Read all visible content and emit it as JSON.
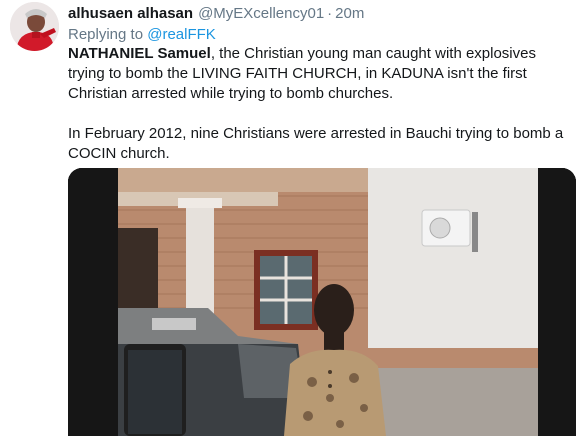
{
  "tweet": {
    "author_name": "alhusaen alhasan",
    "author_handle": "@MyEXcellency01",
    "separator": "·",
    "timestamp": "20m",
    "replying_prefix": "Replying to",
    "replying_to": "@realFFK",
    "body_name": "NATHANIEL Samuel",
    "body_line1_rest": ", the Christian young man caught with explosives trying to bomb the LIVING FAITH CHURCH, in KADUNA isn't the first Christian arrested while trying to bomb churches.",
    "body_para2": "In February 2012, nine Christians were arrested in Bauchi trying to bomb a COCIN church."
  },
  "colors": {
    "text": "#14171a",
    "secondary": "#657786",
    "link": "#1b95e0"
  },
  "icons": {
    "avatar": "profile-photo"
  }
}
